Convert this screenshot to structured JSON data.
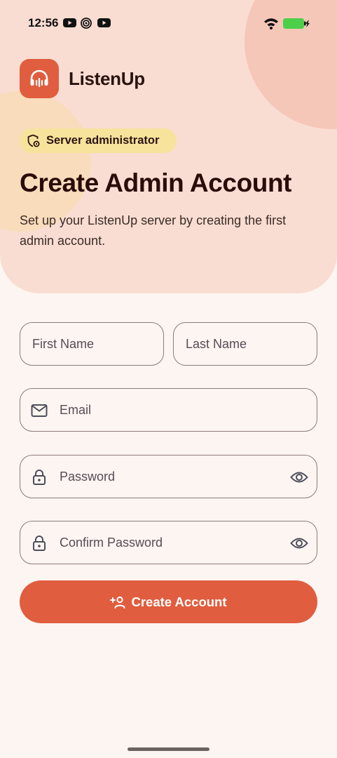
{
  "status_bar": {
    "time": "12:56",
    "notification_icons": [
      "youtube-icon",
      "radar-icon",
      "youtube-icon"
    ],
    "battery_color": "#4cd04a"
  },
  "brand": {
    "name": "ListenUp",
    "logo_icon": "headphones-icon",
    "accent_color": "#e05d3f"
  },
  "badge": {
    "icon": "shield-gear-icon",
    "label": "Server administrator"
  },
  "page": {
    "title": "Create Admin Account",
    "subtitle": "Set up your ListenUp server by creating the first admin account."
  },
  "form": {
    "first_name": {
      "label": "First Name",
      "value": ""
    },
    "last_name": {
      "label": "Last Name",
      "value": ""
    },
    "email": {
      "label": "Email",
      "value": "",
      "icon": "mail-icon"
    },
    "password": {
      "label": "Password",
      "value": "",
      "icon": "lock-icon",
      "toggle_icon": "eye-icon"
    },
    "confirm_password": {
      "label": "Confirm Password",
      "value": "",
      "icon": "lock-icon",
      "toggle_icon": "eye-icon"
    },
    "submit": {
      "label": "Create Account",
      "icon": "person-add-icon"
    }
  }
}
